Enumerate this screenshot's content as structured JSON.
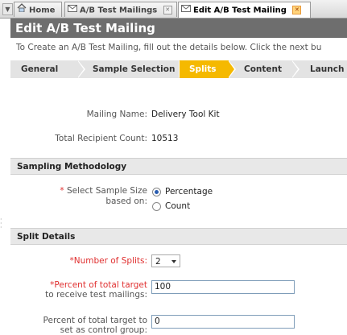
{
  "tabs": [
    {
      "label": "Home",
      "icon": "home-icon"
    },
    {
      "label": "A/B Test Mailings",
      "icon": "envelope-icon"
    },
    {
      "label": "Edit A/B Test Mailing",
      "icon": "envelope-icon",
      "active": true
    }
  ],
  "page_title": "Edit A/B Test Mailing",
  "intro_text": "To Create an A/B Test Mailing, fill out the details below. Click the next bu",
  "steps": [
    "General",
    "Sample Selection",
    "Splits",
    "Content",
    "Launch"
  ],
  "active_step": "Splits",
  "fields": {
    "mailing_name_label": "Mailing Name:",
    "mailing_name_value": "Delivery Tool Kit",
    "recipient_count_label": "Total Recipient Count:",
    "recipient_count_value": "10513"
  },
  "sampling": {
    "section_title": "Sampling Methodology",
    "required_mark": "*",
    "label_line1": "Select Sample Size",
    "label_line2": "based on:",
    "options": [
      "Percentage",
      "Count"
    ],
    "selected": "Percentage"
  },
  "split_details": {
    "section_title": "Split Details",
    "num_splits_label": "*Number of Splits:",
    "num_splits_value": "2",
    "percent_test_label_line1": "*Percent of total target",
    "percent_test_label_line2": "to receive test mailings:",
    "percent_test_value": "100",
    "percent_control_label_line1": "Percent of total target to",
    "percent_control_label_line2": "set as control group:",
    "percent_control_value": "0"
  },
  "colors": {
    "title_bar": "#6e6e6e",
    "active_step": "#f5b900",
    "required": "#e03030"
  }
}
